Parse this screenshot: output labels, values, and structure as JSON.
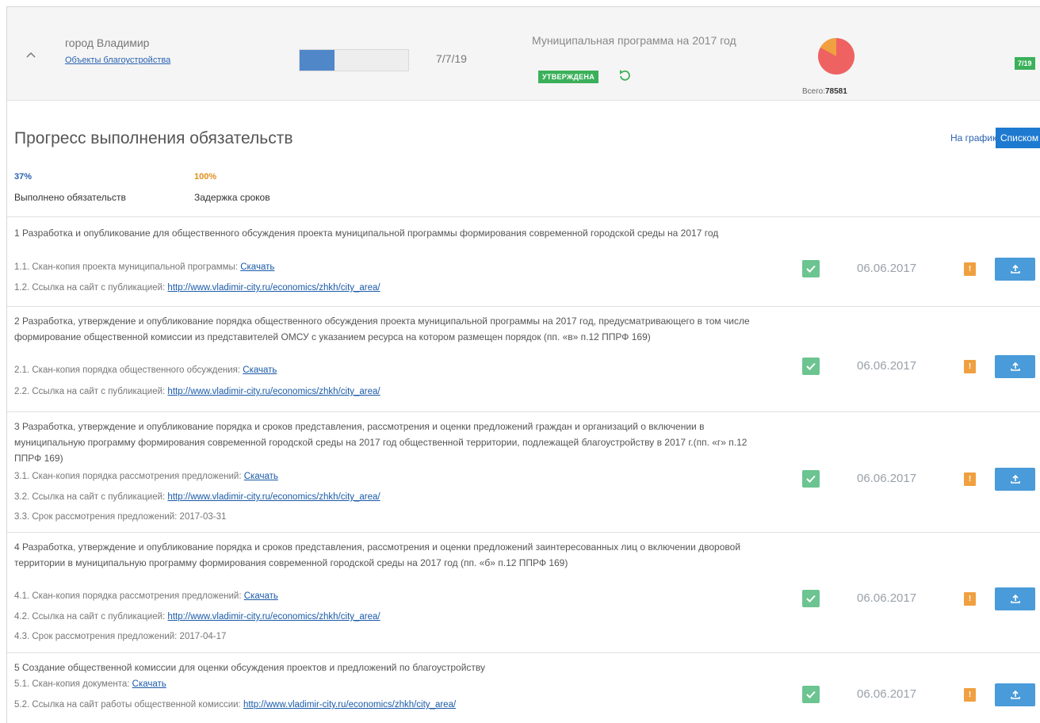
{
  "header": {
    "city": "город Владимир",
    "objects_link": "Объекты благоустройства",
    "progress_fraction": 0.32,
    "progress_text": "7/7/19",
    "program_title": "Муниципальная программа на 2017 год",
    "status": "УТВЕРЖДЕНА",
    "total_label": "Всего:",
    "total_value": "78581",
    "chip": "7/19",
    "pie": {
      "main_color": "#ee6262",
      "slice_color": "#f0a040",
      "slice_fraction": 0.17
    }
  },
  "section": {
    "title": "Прогресс выполнения обязательств",
    "view_graph": "На графике",
    "view_list": "Списком"
  },
  "stats": [
    {
      "value": "37%",
      "label": "Выполнено обязательств"
    },
    {
      "value": "100%",
      "label": "Задержка сроков"
    }
  ],
  "items": [
    {
      "title": "1 Разработка и опубликование для общественного обсуждения проекта муниципальной программы формирования современной городской среды на 2017 год",
      "subs": [
        {
          "text": "1.1. Скан-копия проекта муниципальной программы: ",
          "link": "Скачать"
        },
        {
          "text": "1.2. Ссылка на сайт с публикацией: ",
          "link": "http://www.vladimir-city.ru/economics/zhkh/city_area/"
        }
      ],
      "date": "06.06.2017",
      "warn": "!"
    },
    {
      "title": "2 Разработка, утверждение и опубликование порядка общественного обсуждения проекта муниципальной программы на 2017 год, предусматривающего в том числе формирование общественной комиссии из представителей ОМСУ с указанием ресурса на котором размещен порядок (пп. «в» п.12 ППРФ 169)",
      "subs": [
        {
          "text": "2.1. Скан-копия порядка общественного обсуждения: ",
          "link": "Скачать"
        },
        {
          "text": "2.2. Ссылка на сайт с публикацией: ",
          "link": "http://www.vladimir-city.ru/economics/zhkh/city_area/"
        }
      ],
      "date": "06.06.2017",
      "warn": "!"
    },
    {
      "title": "3 Разработка, утверждение и опубликование порядка и сроков представления, рассмотрения и оценки предложений граждан и организаций о включении в муниципальную программу формирования современной городской среды на 2017 год общественной территории, подлежащей благоустройству в 2017 г.(пп. «г» п.12 ППРФ 169)",
      "subs": [
        {
          "text": "3.1. Скан-копия порядка рассмотрения предложений: ",
          "link": "Скачать"
        },
        {
          "text": "3.2. Ссылка на сайт с публикацией: ",
          "link": "http://www.vladimir-city.ru/economics/zhkh/city_area/"
        },
        {
          "text": "3.3. Срок рассмотрения предложений: 2017-03-31",
          "link": ""
        }
      ],
      "date": "06.06.2017",
      "warn": "!"
    },
    {
      "title": "4 Разработка, утверждение и опубликование порядка и сроков представления, рассмотрения и оценки предложений заинтересованных лиц о включении дворовой территории в муниципальную программу формирования современной городской среды на 2017 год (пп. «б» п.12 ППРФ 169)",
      "subs": [
        {
          "text": "4.1. Скан-копия порядка рассмотрения предложений: ",
          "link": "Скачать"
        },
        {
          "text": "4.2. Ссылка на сайт с публикацией: ",
          "link": "http://www.vladimir-city.ru/economics/zhkh/city_area/"
        },
        {
          "text": "4.3. Срок рассмотрения предложений: 2017-04-17",
          "link": ""
        }
      ],
      "date": "06.06.2017",
      "warn": "!"
    },
    {
      "title": "5 Создание общественной комиссии для оценки обсуждения проектов и предложений по благоустройству",
      "subs": [
        {
          "text": "5.1. Скан-копия документа: ",
          "link": "Скачать"
        },
        {
          "text": "5.2. Ссылка на сайт работы общественной комиссии: ",
          "link": "http://www.vladimir-city.ru/economics/zhkh/city_area/"
        }
      ],
      "date": "06.06.2017",
      "warn": "!"
    }
  ]
}
